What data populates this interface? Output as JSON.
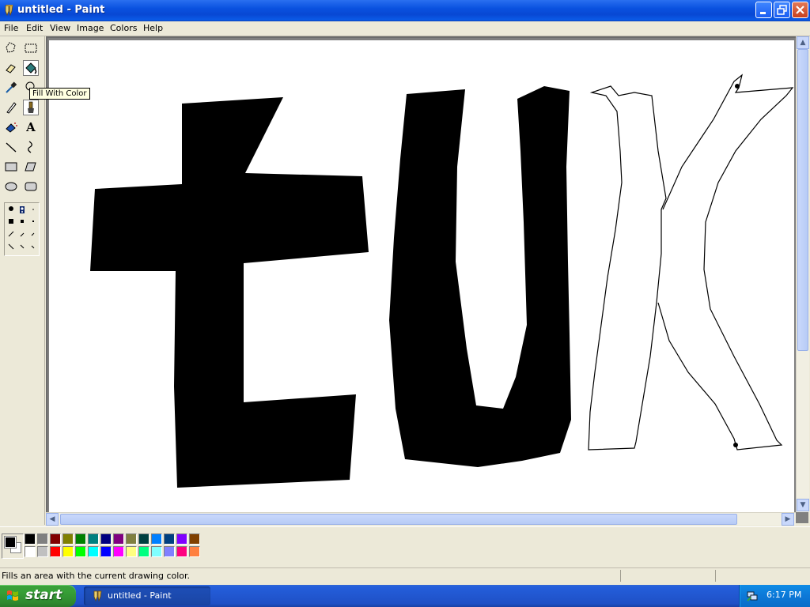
{
  "window": {
    "title": "untitled - Paint",
    "menus": [
      "File",
      "Edit",
      "View",
      "Image",
      "Colors",
      "Help"
    ]
  },
  "tools": [
    {
      "name": "free-form-select-icon"
    },
    {
      "name": "select-icon"
    },
    {
      "name": "eraser-icon"
    },
    {
      "name": "fill-with-color-icon",
      "selected": true
    },
    {
      "name": "pick-color-icon"
    },
    {
      "name": "magnifier-icon"
    },
    {
      "name": "pencil-icon"
    },
    {
      "name": "brush-icon"
    },
    {
      "name": "airbrush-icon"
    },
    {
      "name": "text-icon"
    },
    {
      "name": "line-icon"
    },
    {
      "name": "curve-icon"
    },
    {
      "name": "rectangle-icon"
    },
    {
      "name": "polygon-icon"
    },
    {
      "name": "ellipse-icon"
    },
    {
      "name": "rounded-rectangle-icon"
    }
  ],
  "tooltip": "Fill With Color",
  "tool_text_glyph": "A",
  "canvas": {
    "background": "#ffffff",
    "stroke_color": "#000000"
  },
  "palette": {
    "foreground": "#000000",
    "background": "#ffffff",
    "row1": [
      "#000000",
      "#808080",
      "#800000",
      "#808000",
      "#008000",
      "#008080",
      "#000080",
      "#800080",
      "#808040",
      "#004040",
      "#0080ff",
      "#004080",
      "#8000ff",
      "#804000"
    ],
    "row2": [
      "#ffffff",
      "#c0c0c0",
      "#ff0000",
      "#ffff00",
      "#00ff00",
      "#00ffff",
      "#0000ff",
      "#ff00ff",
      "#ffff80",
      "#00ff80",
      "#80ffff",
      "#8080ff",
      "#ff0080",
      "#ff8040"
    ]
  },
  "status": {
    "text": "Fills an area with the current drawing color."
  },
  "taskbar": {
    "start_label": "start",
    "task_label": "untitled - Paint",
    "clock": "6:17 PM"
  }
}
